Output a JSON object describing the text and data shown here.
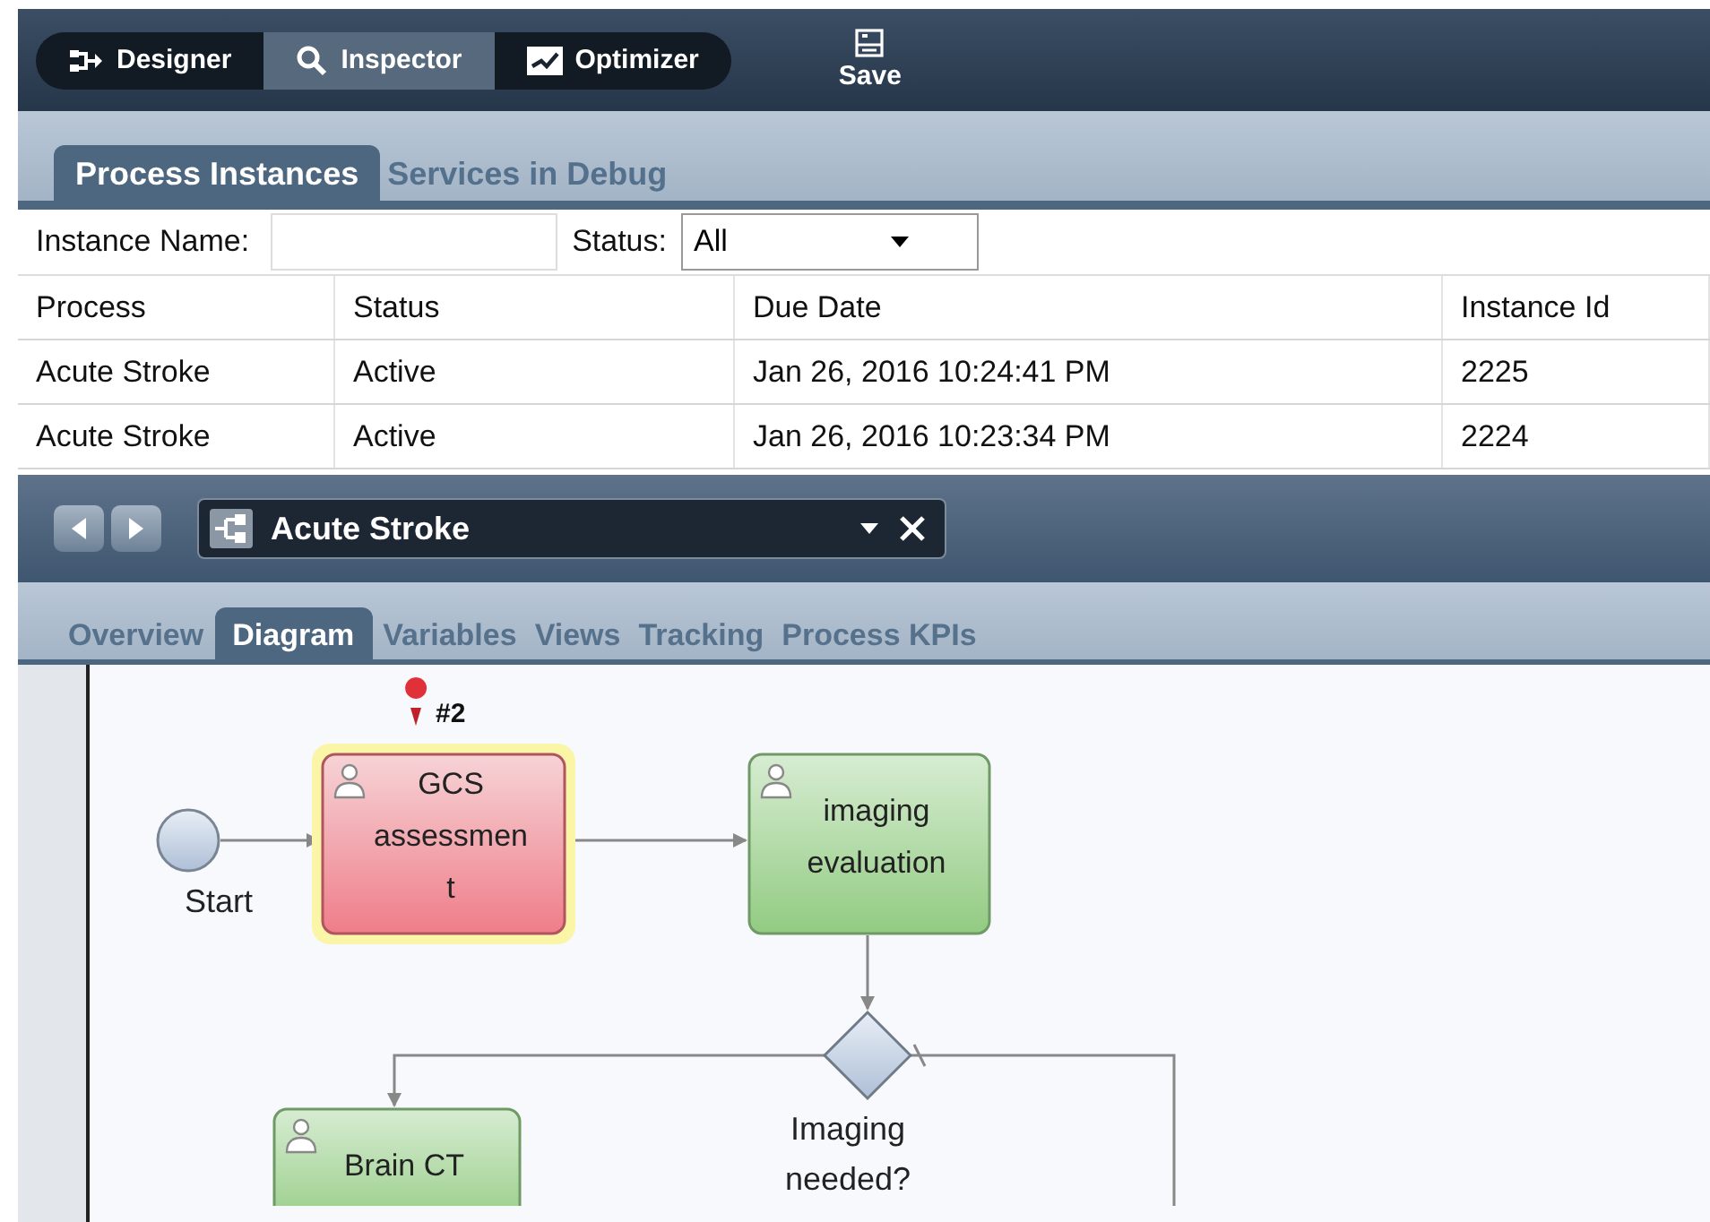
{
  "toolbar": {
    "modes": [
      {
        "kind": "designer",
        "label": "Designer",
        "selected": false
      },
      {
        "kind": "inspector",
        "label": "Inspector",
        "selected": true
      },
      {
        "kind": "optimizer",
        "label": "Optimizer",
        "selected": false
      }
    ],
    "save": "Save"
  },
  "panel_tabs": [
    {
      "label": "Process Instances",
      "selected": true
    },
    {
      "label": "Services in Debug",
      "selected": false
    }
  ],
  "filter": {
    "instance_name_label": "Instance Name:",
    "status_label": "Status:",
    "status_value": "All"
  },
  "table": {
    "columns": [
      "Process",
      "Status",
      "Due Date",
      "Instance Id"
    ],
    "rows": [
      [
        "Acute Stroke",
        "Active",
        "Jan 26, 2016 10:24:41 PM",
        "2225"
      ],
      [
        "Acute Stroke",
        "Active",
        "Jan 26, 2016 10:23:34 PM",
        "2224"
      ]
    ]
  },
  "editor": {
    "title": "Acute Stroke",
    "tabs": [
      {
        "label": "Overview",
        "selected": false
      },
      {
        "label": "Diagram",
        "selected": true
      },
      {
        "label": "Variables",
        "selected": false
      },
      {
        "label": "Views",
        "selected": false
      },
      {
        "label": "Tracking",
        "selected": false
      },
      {
        "label": "Process KPIs",
        "selected": false
      }
    ]
  },
  "diagram": {
    "nodes": [
      {
        "kind": "start",
        "lines": [
          "Start"
        ]
      },
      {
        "kind": "task",
        "lines": [
          "GCS",
          "assessmen",
          "t"
        ],
        "active": true,
        "marker": "#2"
      },
      {
        "kind": "task",
        "lines": [
          "imaging",
          "evaluation"
        ],
        "active": false
      },
      {
        "kind": "task",
        "lines": [
          "Brain CT"
        ],
        "active": false
      },
      {
        "kind": "gateway",
        "lines": [
          "Imaging",
          "needed?"
        ]
      }
    ]
  }
}
